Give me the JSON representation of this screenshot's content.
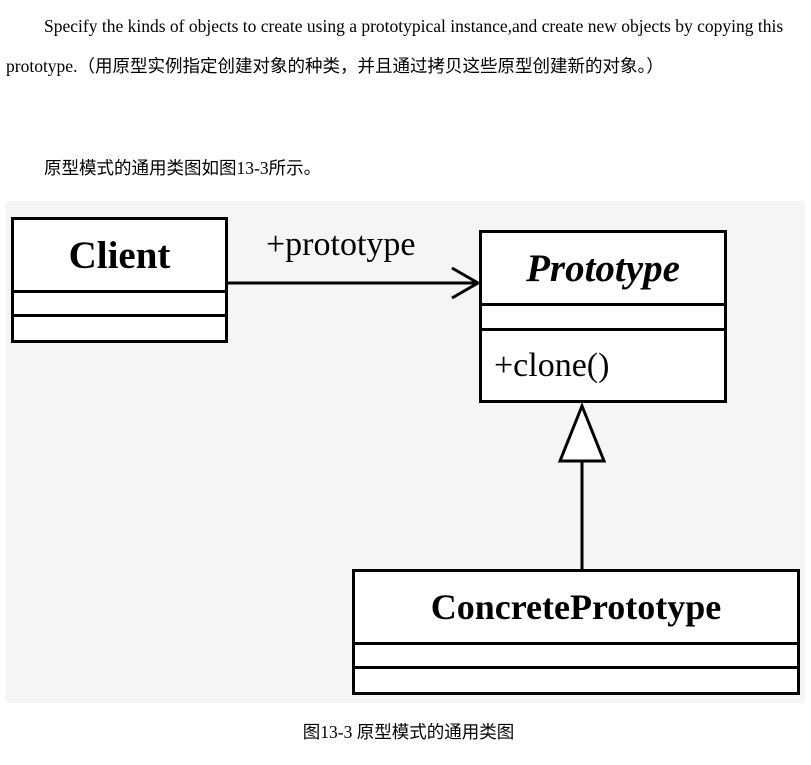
{
  "intro": {
    "definition": "Specify the kinds of objects to create using a prototypical instance,and create new objects by copying this prototype.（用原型实例指定创建对象的种类，并且通过拷贝这些原型创建新的对象。）",
    "diagram_intro": "原型模式的通用类图如图13-3所示。"
  },
  "diagram": {
    "classes": {
      "client": {
        "name": "Client"
      },
      "prototype": {
        "name": "Prototype",
        "operation": "+clone()"
      },
      "concrete": {
        "name": "ConcretePrototype"
      }
    },
    "association_label": "+prototype",
    "caption": "图13-3 原型模式的通用类图"
  }
}
